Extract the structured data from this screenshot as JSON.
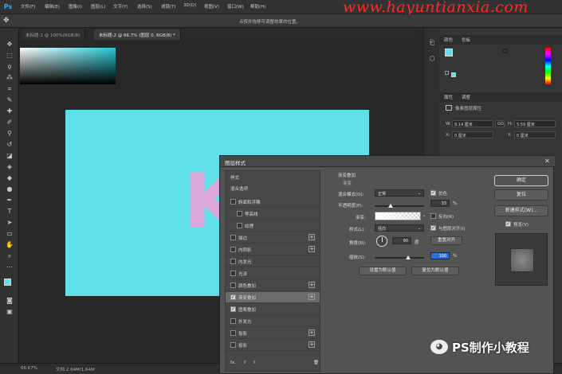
{
  "app": {
    "logo": "Ps"
  },
  "menubar": {
    "items": [
      "文件(F)",
      "编辑(E)",
      "图像(I)",
      "图层(L)",
      "文字(Y)",
      "选择(S)",
      "滤镜(T)",
      "3D(D)",
      "视图(V)",
      "窗口(W)",
      "帮助(H)"
    ]
  },
  "watermark": "www.hayuntianxia.com",
  "optionsbar": {
    "hint": "点按并拖移可调整效果的位置。"
  },
  "tabs": [
    {
      "label": "未标题-1 @ 100%(RGB/8)"
    },
    {
      "label": "未标题-2 @ 66.7% (图层 0, RGB/8) *"
    }
  ],
  "canvas": {
    "letter": "K",
    "artboard_color": "#5fe0e8",
    "letter_color": "#dba6d9"
  },
  "status": {
    "zoom": "66.67%",
    "doc": "文档:2.64M/1.64M"
  },
  "panels": {
    "color_tabs": [
      "颜色",
      "色板"
    ],
    "props_tabs": [
      "属性",
      "调整"
    ],
    "props_title": "像素图层属性",
    "w_label": "W:",
    "w_value": "9.14 厘米",
    "h_label": "H:",
    "h_value": "5.59 厘米",
    "x_label": "X:",
    "x_value": "0 厘米",
    "y_label": "Y:",
    "y_value": "0 厘米",
    "link_label": "GO"
  },
  "dialog": {
    "title": "图层样式",
    "close": "✕",
    "styles_header": "样式",
    "blend_options": "混合选项",
    "style_rows": [
      {
        "label": "斜面和浮雕",
        "checked": false,
        "plus": false,
        "indent": false
      },
      {
        "label": "等高线",
        "checked": false,
        "plus": false,
        "indent": true
      },
      {
        "label": "纹理",
        "checked": false,
        "plus": false,
        "indent": true
      },
      {
        "label": "描边",
        "checked": false,
        "plus": true,
        "indent": false
      },
      {
        "label": "内阴影",
        "checked": false,
        "plus": true,
        "indent": false
      },
      {
        "label": "内发光",
        "checked": false,
        "plus": false,
        "indent": false
      },
      {
        "label": "光泽",
        "checked": false,
        "plus": false,
        "indent": false
      },
      {
        "label": "颜色叠加",
        "checked": false,
        "plus": true,
        "indent": false
      },
      {
        "label": "渐变叠加",
        "checked": true,
        "plus": true,
        "indent": false,
        "selected": true
      },
      {
        "label": "图案叠加",
        "checked": true,
        "plus": false,
        "indent": false
      },
      {
        "label": "外发光",
        "checked": false,
        "plus": false,
        "indent": false
      },
      {
        "label": "投影",
        "checked": false,
        "plus": true,
        "indent": false
      },
      {
        "label": "投影",
        "checked": false,
        "plus": true,
        "indent": false
      }
    ],
    "footer_fx": "fx.",
    "gradient": {
      "section_title": "渐变叠加",
      "sub_title": "渐变",
      "blend_mode_label": "混合模式(O):",
      "blend_mode_value": "正常",
      "dither_label": "仿色",
      "dither_checked": true,
      "opacity_label": "不透明度(P):",
      "opacity_value": "33",
      "opacity_fraction": 0.33,
      "percent": "%",
      "gradient_label": "渐变:",
      "reverse_label": "反向(R)",
      "reverse_checked": false,
      "style_label": "样式(L):",
      "style_value": "径向",
      "align_label": "与图层对齐(I)",
      "align_checked": true,
      "angle_label": "角度(N):",
      "angle_value": "90",
      "degree": "度",
      "reset_align": "重置对齐",
      "scale_label": "缩放(S):",
      "scale_value": "100",
      "scale_fraction": 0.67,
      "make_default": "设置为默认值",
      "reset_default": "复位为默认值"
    },
    "buttons": {
      "ok": "确定",
      "reset": "复位",
      "new_style": "新建样式(W)...",
      "preview_label": "预览(V)",
      "preview_checked": true
    }
  },
  "wechat": {
    "text": "PS制作小教程"
  }
}
